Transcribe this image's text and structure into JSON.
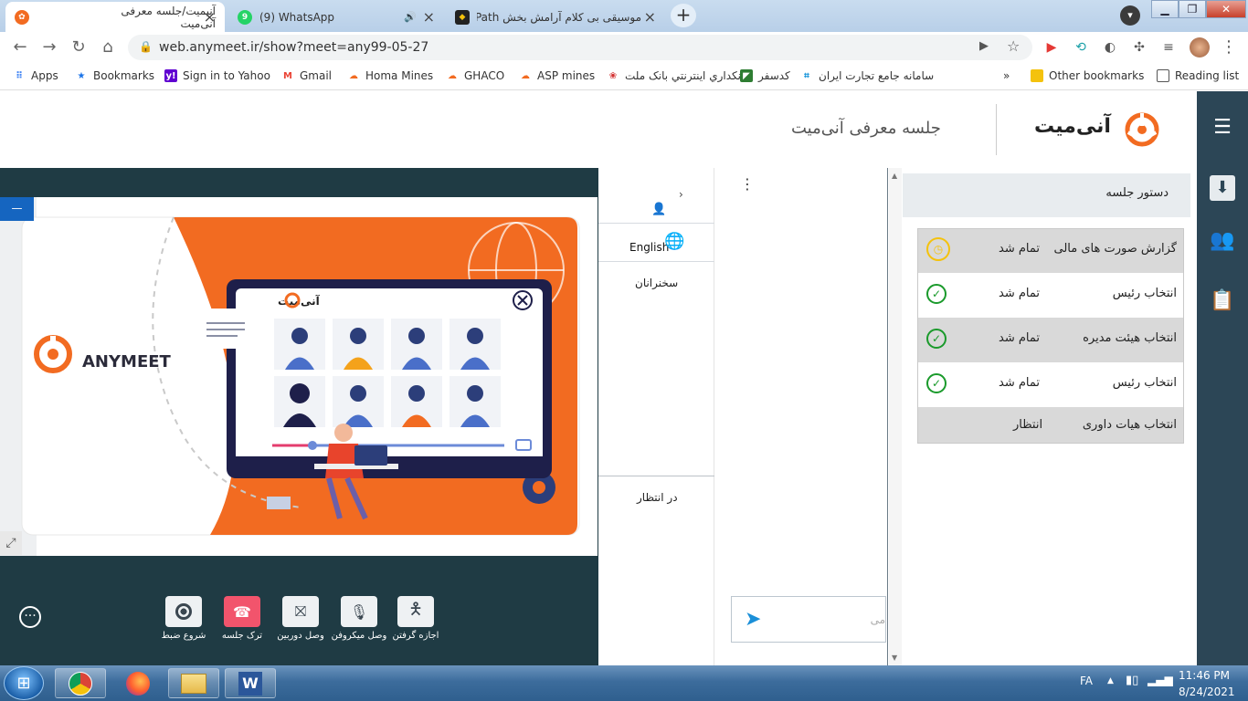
{
  "browser": {
    "tabs": [
      {
        "title": "آنیمیت/جلسه معرفی آنی‌میت",
        "active": true
      },
      {
        "title": "(9) WhatsApp",
        "badge": "9",
        "active": false
      },
      {
        "title": "موسیقی بی کلام آرامش بخش Seven Path",
        "active": false
      }
    ],
    "url": "web.anymeet.ir/show?meet=any99-05-27",
    "bookmarks": [
      {
        "label": "Apps",
        "icon": "apps-grid-icon"
      },
      {
        "label": "Bookmarks",
        "icon": "star-icon"
      },
      {
        "label": "Sign in to Yahoo",
        "icon": "yahoo-icon"
      },
      {
        "label": "Gmail",
        "icon": "gmail-icon"
      },
      {
        "label": "Homa Mines",
        "icon": "cloud-icon"
      },
      {
        "label": "GHACO",
        "icon": "cloud-icon"
      },
      {
        "label": "ASP mines",
        "icon": "cloud-icon"
      },
      {
        "label": "بانکداري اينترنتي بانک ملت",
        "icon": "mellat-icon"
      },
      {
        "label": "کدسفر",
        "icon": "codesafar-icon"
      },
      {
        "label": "سامانه جامع تجارت ایران",
        "icon": "ntsw-icon"
      }
    ],
    "other_bookmarks": "Other bookmarks",
    "reading_list": "Reading list",
    "more_chevron": "»"
  },
  "app": {
    "brand": "آنی‌میت",
    "meeting_title": "جلسه معرفی آنی‌میت",
    "minimize_label": "—"
  },
  "slide": {
    "brand_latin": "ANYMEET",
    "window_brand": "آنی‌میت"
  },
  "controls": [
    {
      "label": "شروع ضبط",
      "icon": "record-icon"
    },
    {
      "label": "ترک جلسه",
      "icon": "hangup-icon"
    },
    {
      "label": "وصل دوربین",
      "icon": "camera-off-icon"
    },
    {
      "label": "وصل میکروفن",
      "icon": "mic-off-icon"
    },
    {
      "label": "اجازه گرفتن",
      "icon": "raise-hand-icon"
    }
  ],
  "speakers": {
    "language": "English",
    "speakers_label": "سخنرانان",
    "waiting_label": "در انتظار"
  },
  "chat": {
    "placeholder_fragment": "می"
  },
  "agenda": {
    "title": "دستور جلسه",
    "items": [
      {
        "title": "گزارش صورت های مالی",
        "status": "تمام شد",
        "icon": "clock-icon"
      },
      {
        "title": "انتخاب رئیس",
        "status": "تمام شد",
        "icon": "check-circle-icon"
      },
      {
        "title": "انتخاب هیئت مدیره",
        "status": "تمام شد",
        "icon": "check-circle-icon"
      },
      {
        "title": "انتخاب رئیس",
        "status": "تمام شد",
        "icon": "check-circle-icon"
      },
      {
        "title": "انتخاب هیات داوری",
        "status": "انتظار",
        "icon": ""
      }
    ]
  },
  "taskbar": {
    "lang": "FA",
    "time": "11:46 PM",
    "date": "8/24/2021"
  },
  "colors": {
    "brand_orange": "#f26b21",
    "sidebar_dark": "#2c4656",
    "video_bg": "#1f3b44",
    "check_green": "#1a9a2b",
    "clock_yellow": "#f4c20d"
  }
}
